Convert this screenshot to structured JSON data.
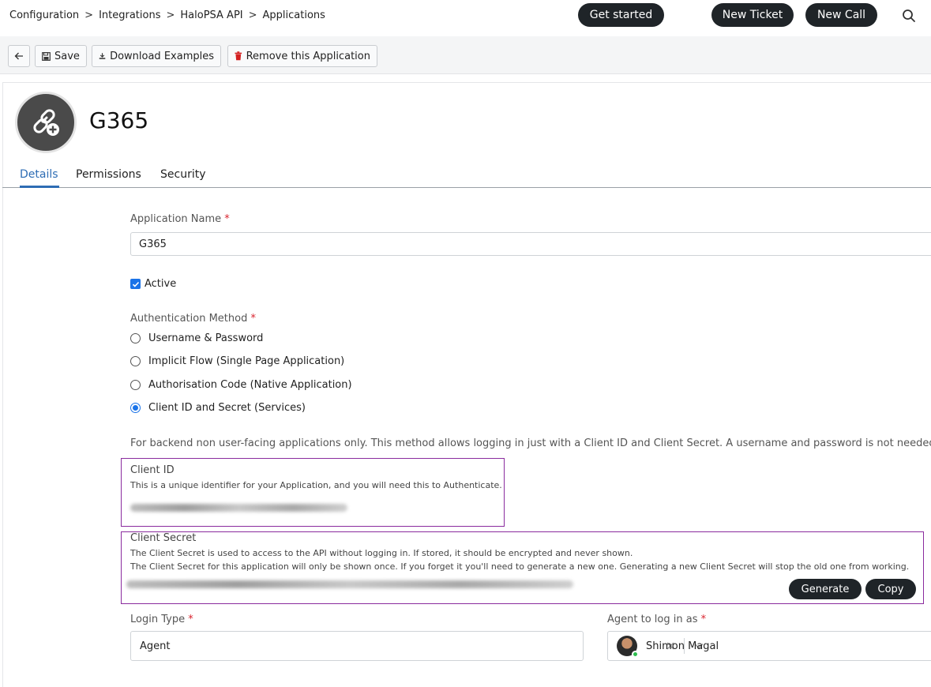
{
  "breadcrumb": [
    "Configuration",
    "Integrations",
    "HaloPSA API",
    "Applications"
  ],
  "breadcrumb_separator": ">",
  "header": {
    "get_started": "Get started",
    "new_ticket": "New Ticket",
    "new_call": "New Call",
    "search_icon": "search-icon"
  },
  "toolbar": {
    "back_icon": "arrow-left-icon",
    "save": "Save",
    "download_examples": "Download Examples",
    "remove": "Remove this Application"
  },
  "app": {
    "title": "G365",
    "icon": "link-add-icon"
  },
  "tabs": [
    "Details",
    "Permissions",
    "Security"
  ],
  "active_tab": "Details",
  "form": {
    "app_name_label": "Application Name",
    "required_mark": "*",
    "app_name_value": "G365",
    "active_label": "Active",
    "active_checked": true,
    "auth_label": "Authentication Method",
    "auth_options": [
      "Username & Password",
      "Implicit Flow (Single Page Application)",
      "Authorisation Code (Native Application)",
      "Client ID and Secret (Services)"
    ],
    "auth_selected": "Client ID and Secret (Services)",
    "auth_description": "For backend non user-facing applications only. This method allows logging in just with a Client ID and Client Secret. A username and password is not needed",
    "client_id_label": "Client ID",
    "client_id_help": "This is a unique identifier for your Application, and you will need this to Authenticate.",
    "client_secret_label": "Client Secret",
    "client_secret_help_1": "The Client Secret is used to access to the API without logging in. If stored, it should be encrypted and never shown.",
    "client_secret_help_2": "The Client Secret for this application will only be shown once. If you forget it you'll need to generate a new one. Generating a new Client Secret will stop the old one from working.",
    "generate": "Generate",
    "copy": "Copy",
    "login_type_label": "Login Type",
    "login_type_value": "Agent",
    "agent_label": "Agent to log in as",
    "agent_value": "Shimon Magal"
  },
  "colors": {
    "accent": "#2e6db4",
    "dark_button": "#1f2428",
    "highlight_border": "#8a2b9e",
    "required": "#d9232e"
  }
}
